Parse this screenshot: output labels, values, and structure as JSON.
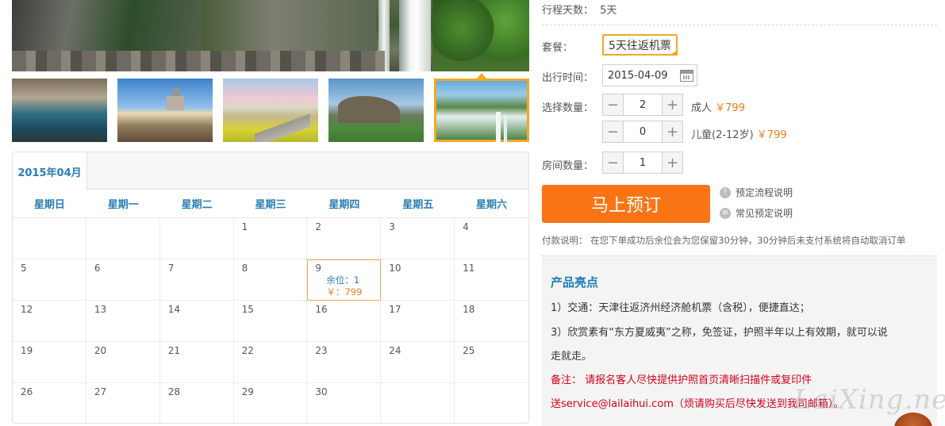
{
  "calendar": {
    "month_tab": "2015年04月",
    "weekdays": [
      "星期日",
      "星期一",
      "星期二",
      "星期三",
      "星期四",
      "星期五",
      "星期六"
    ],
    "days": [
      {
        "d": ""
      },
      {
        "d": ""
      },
      {
        "d": ""
      },
      {
        "d": "1"
      },
      {
        "d": "2"
      },
      {
        "d": "3"
      },
      {
        "d": "4"
      },
      {
        "d": "5"
      },
      {
        "d": "6"
      },
      {
        "d": "7"
      },
      {
        "d": "8"
      },
      {
        "d": "9",
        "seat": "余位：1",
        "price": "￥：799"
      },
      {
        "d": "10"
      },
      {
        "d": "11"
      },
      {
        "d": "12"
      },
      {
        "d": "13"
      },
      {
        "d": "14"
      },
      {
        "d": "15"
      },
      {
        "d": "16"
      },
      {
        "d": "17"
      },
      {
        "d": "18"
      },
      {
        "d": "19"
      },
      {
        "d": "20"
      },
      {
        "d": "21"
      },
      {
        "d": "22"
      },
      {
        "d": "23"
      },
      {
        "d": "24"
      },
      {
        "d": "25"
      },
      {
        "d": "26"
      },
      {
        "d": "27"
      },
      {
        "d": "28"
      },
      {
        "d": "29"
      },
      {
        "d": "30"
      },
      {
        "d": ""
      },
      {
        "d": ""
      }
    ]
  },
  "booking": {
    "days_label": "行程天数：",
    "days_value": "5天",
    "package_label": "套餐：",
    "package_value": "5天往返机票",
    "date_label": "出行时间：",
    "date_value": "2015-04-09",
    "qty_label": "选择数量：",
    "adult_qty": "2",
    "adult_label": "成人",
    "adult_price": "￥799",
    "child_qty": "0",
    "child_label": "儿童(2-12岁)",
    "child_price": "￥799",
    "room_label": "房间数量：",
    "room_qty": "1",
    "minus": "−",
    "plus": "+",
    "book_button": "马上预订",
    "help1": "预定流程说明",
    "help2": "常见预定说明",
    "help1_icon": "!",
    "help2_icon": "≡",
    "payment_note": "付款说明：  在您下单成功后余位会为您保留30分钟，30分钟后未支付系统将自动取消订单"
  },
  "highlights": {
    "title": "产品亮点",
    "line1": "1）交通：天津往返济州经济舱机票（含税），便捷直达；",
    "line2": "3）欣赏素有“东方夏威夷”之称，免签证，护照半年以上有效期，就可以说",
    "line3": "走就走。",
    "note1": "备注：  请报名客人尽快提供护照首页清晰扫描件或复印件",
    "note2": "送service@lailaihui.com（烦请购买后尽快发送到我司邮箱）。"
  },
  "watermark": "LaiXing.net",
  "colors": {
    "accent": "#f97414",
    "link_blue": "#2a7db3",
    "price_orange": "#f07c1a",
    "note_red": "#d0021b",
    "selected_border": "#f5a623"
  }
}
